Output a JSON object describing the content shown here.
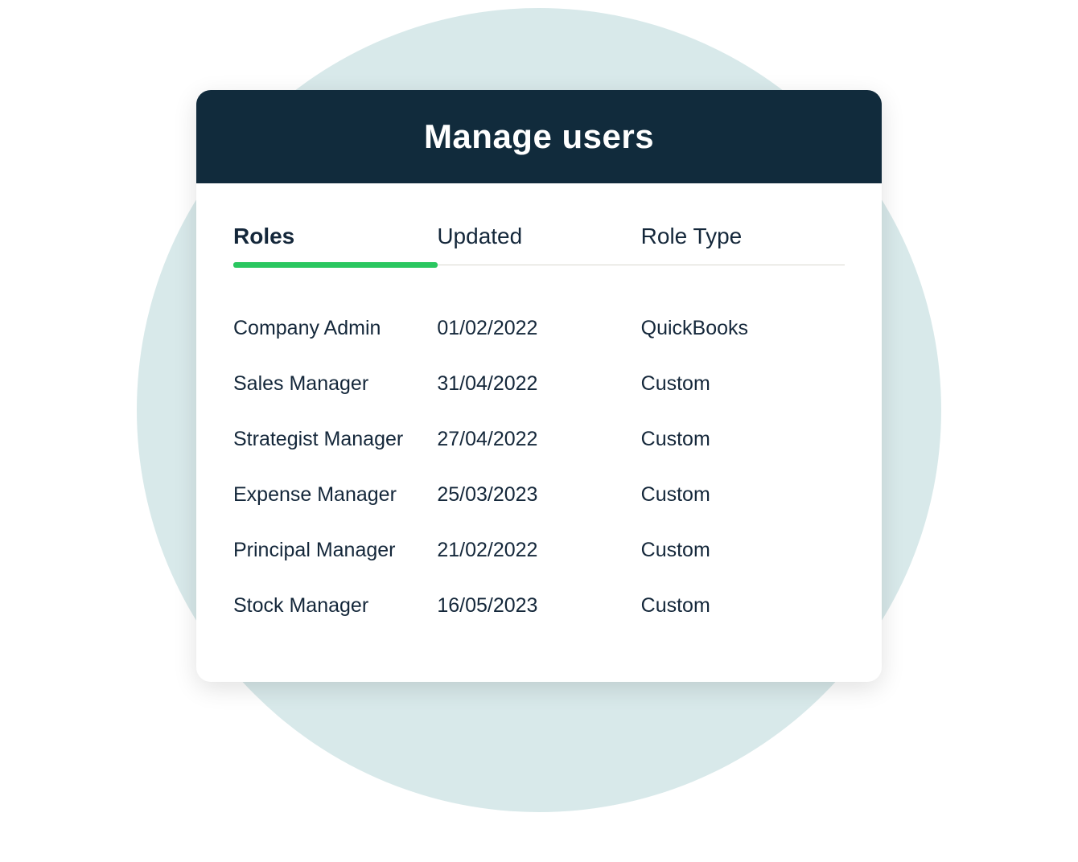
{
  "header": {
    "title": "Manage users"
  },
  "columns": {
    "roles": "Roles",
    "updated": "Updated",
    "role_type": "Role Type"
  },
  "rows": [
    {
      "role": "Company Admin",
      "updated": "01/02/2022",
      "type": "QuickBooks"
    },
    {
      "role": "Sales Manager",
      "updated": "31/04/2022",
      "type": "Custom"
    },
    {
      "role": "Strategist Manager",
      "updated": "27/04/2022",
      "type": "Custom"
    },
    {
      "role": "Expense Manager",
      "updated": "25/03/2023",
      "type": "Custom"
    },
    {
      "role": "Principal Manager",
      "updated": "21/02/2022",
      "type": "Custom"
    },
    {
      "role": "Stock Manager",
      "updated": "16/05/2023",
      "type": "Custom"
    }
  ],
  "colors": {
    "header_bg": "#112b3c",
    "accent_green": "#2ac760",
    "circle_bg": "#d8e9ea",
    "text_dark": "#14273a"
  }
}
